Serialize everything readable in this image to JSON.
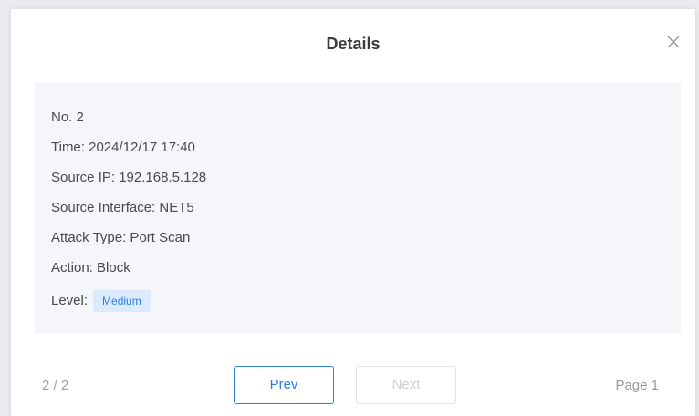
{
  "dialog": {
    "title": "Details"
  },
  "details": {
    "no": "No. 2",
    "time": "Time: 2024/12/17 17:40",
    "source_ip": "Source IP: 192.168.5.128",
    "source_interface": "Source Interface: NET5",
    "attack_type": "Attack Type: Port Scan",
    "action": "Action: Block",
    "level_label": "Level:",
    "level_value": "Medium"
  },
  "footer": {
    "count": "2 / 2",
    "prev_label": "Prev",
    "next_label": "Next",
    "page_label": "Page 1"
  },
  "icons": {
    "close": "close-icon"
  },
  "colors": {
    "accent": "#2f7fe0",
    "badge_bg": "#dbeafd",
    "panel_bg": "#f4f6f9"
  }
}
